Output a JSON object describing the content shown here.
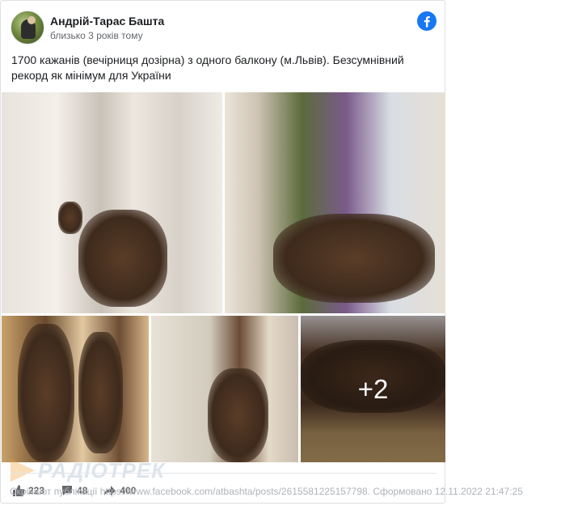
{
  "post": {
    "author": "Андрій-Тарас Башта",
    "time": "близько 3 років тому",
    "text_line1": "1700 кажанів (вечірниця дозірна) з одного балкону (м.Львів). Безсумнівний",
    "text_line2": "рекорд як мінімум для України",
    "more_photos": "+2"
  },
  "icons": {
    "brand": "facebook-icon",
    "like": "thumbs-up-icon",
    "comment": "comment-icon",
    "share": "share-icon"
  },
  "watermark": {
    "text": "РАДІОТРЕК"
  },
  "stats": {
    "likes": "223",
    "comments": "48",
    "shares": "400"
  },
  "footer": {
    "note": "Скріншот публікації https://www.facebook.com/atbashta/posts/2615581225157798. Сформовано 12.11.2022 21:47:25"
  },
  "colors": {
    "facebook_blue": "#1877f2",
    "text": "#1c1e21",
    "muted": "#65676b"
  }
}
